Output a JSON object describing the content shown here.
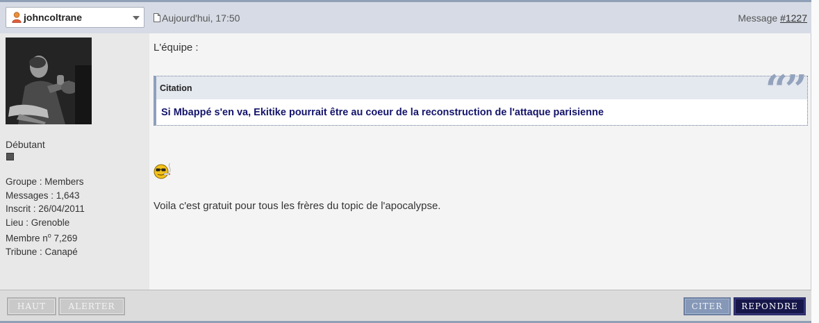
{
  "header": {
    "username": "johncoltrane",
    "post_date": "Aujourd'hui, 17:50",
    "message_prefix": "Message ",
    "message_number": "#1227"
  },
  "sidebar": {
    "rank": "Débutant",
    "stats": {
      "group": "Groupe : Members",
      "messages": "Messages : 1,643",
      "joined": "Inscrit : 26/04/2011",
      "location": "Lieu : Grenoble",
      "member_prefix": "Membre n",
      "member_sup": "o",
      "member_number": " 7,269",
      "tribune": "Tribune : Canapé"
    }
  },
  "post": {
    "intro": "L'équipe :",
    "quote_label": "Citation",
    "quote_text": "Si Mbappé s'en va, Ekitike pourrait être au coeur de la reconstruction de l'attaque parisienne",
    "body_text": "Voila c'est gratuit pour tous les frères du topic de l'apocalypse."
  },
  "footer": {
    "haut": "HAUT",
    "alerter": "ALERTER",
    "citer": "CITER",
    "repondre": "REPONDRE"
  },
  "icons": {
    "user": "user-icon",
    "dropdown": "chevron-down-icon",
    "document": "document-icon",
    "quote": "quote-icon",
    "smiley": "smiley-smoking-icon"
  },
  "colors": {
    "header_bg": "#d6dbe5",
    "quote_text": "#14146b",
    "citer_button": "#8698b8",
    "repondre_button": "#16164a"
  }
}
